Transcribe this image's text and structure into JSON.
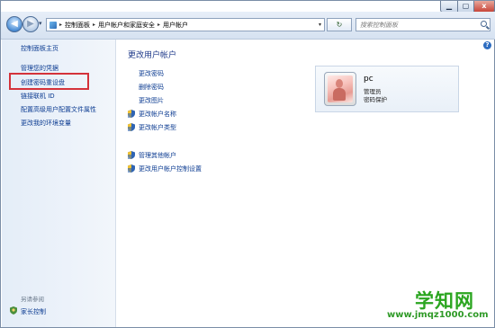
{
  "window": {
    "minimize_icon": "minimize-icon",
    "maximize_icon": "maximize-icon",
    "close_label": "x"
  },
  "navbar": {
    "breadcrumb": [
      "控制面板",
      "用户帐户和家庭安全",
      "用户帐户"
    ],
    "breadcrumb_separator": "▸",
    "search_placeholder": "搜索控制面板",
    "refresh_glyph": "↻"
  },
  "left_pane": {
    "home": "控制面板主页",
    "links": [
      "管理您的凭据",
      "创建密码重设盘",
      "链接联机 ID",
      "配置高级用户配置文件属性",
      "更改我的环境变量"
    ],
    "see_also": "另请参阅",
    "parental_controls": "家长控制"
  },
  "main": {
    "title": "更改用户帐户",
    "links": [
      "更改密码",
      "删除密码",
      "更改图片",
      "更改帐户名称",
      "更改帐户类型"
    ],
    "other_links": [
      "管理其他帐户",
      "更改用户帐户控制设置"
    ]
  },
  "user": {
    "name": "pc",
    "role": "管理员",
    "status": "密码保护"
  },
  "help": "?",
  "watermark": {
    "logo": "学知网",
    "url": "www.jmqz1000.com"
  },
  "colors": {
    "link": "#0b3b91",
    "highlight": "#d4323a",
    "watermark": "#2aa51f"
  }
}
